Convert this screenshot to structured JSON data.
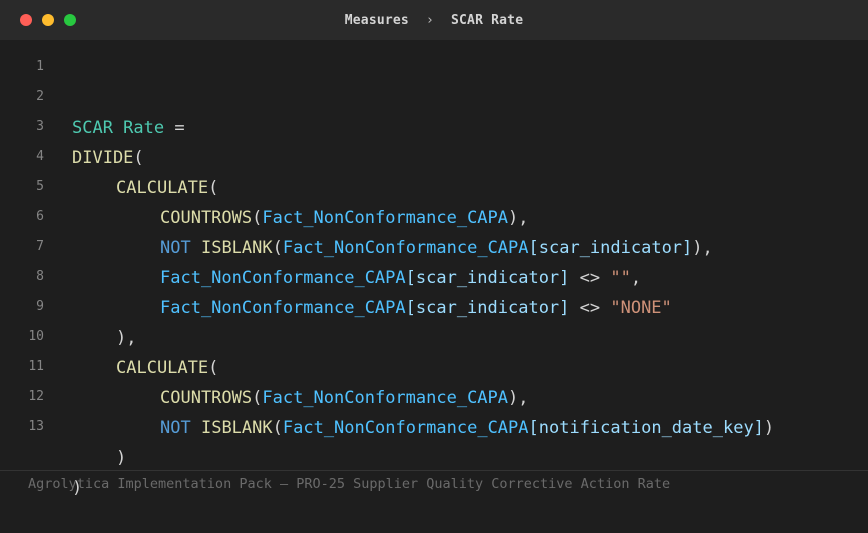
{
  "window": {
    "breadcrumb": [
      "Measures",
      "SCAR Rate"
    ],
    "breadcrumb_separator": "›",
    "traffic_lights": {
      "close": "#ff5f57",
      "minimize": "#febc2e",
      "zoom": "#28c840"
    }
  },
  "editor": {
    "line_numbers": [
      "1",
      "2",
      "3",
      "4",
      "5",
      "6",
      "7",
      "8",
      "9",
      "10",
      "11",
      "12",
      "13"
    ],
    "tokens": {
      "measure_name": "SCAR Rate",
      "assign": " =",
      "divide": "DIVIDE",
      "calculate": "CALCULATE",
      "countrows": "COUNTROWS",
      "not": "NOT",
      "isblank": "ISBLANK",
      "table": "Fact_NonConformance_CAPA",
      "col_scar": "[scar_indicator]",
      "col_notification": "[notification_date_key]",
      "neq": " <> ",
      "empty_string": "\"\"",
      "none_string": "\"NONE\"",
      "open_paren": "(",
      "close_paren": ")",
      "close_paren_comma": "),",
      "comma": ",",
      "close_two_comma": "]),",
      "close_two": "])"
    },
    "colors": {
      "measure": "#4ec9b0",
      "function": "#dcdcaa",
      "keyword": "#569cd6",
      "table": "#4fc1ff",
      "column": "#9cdcfe",
      "string": "#ce9178"
    }
  },
  "footer": {
    "text": "Agrolytica Implementation Pack — PRO-25 Supplier Quality Corrective Action Rate"
  }
}
